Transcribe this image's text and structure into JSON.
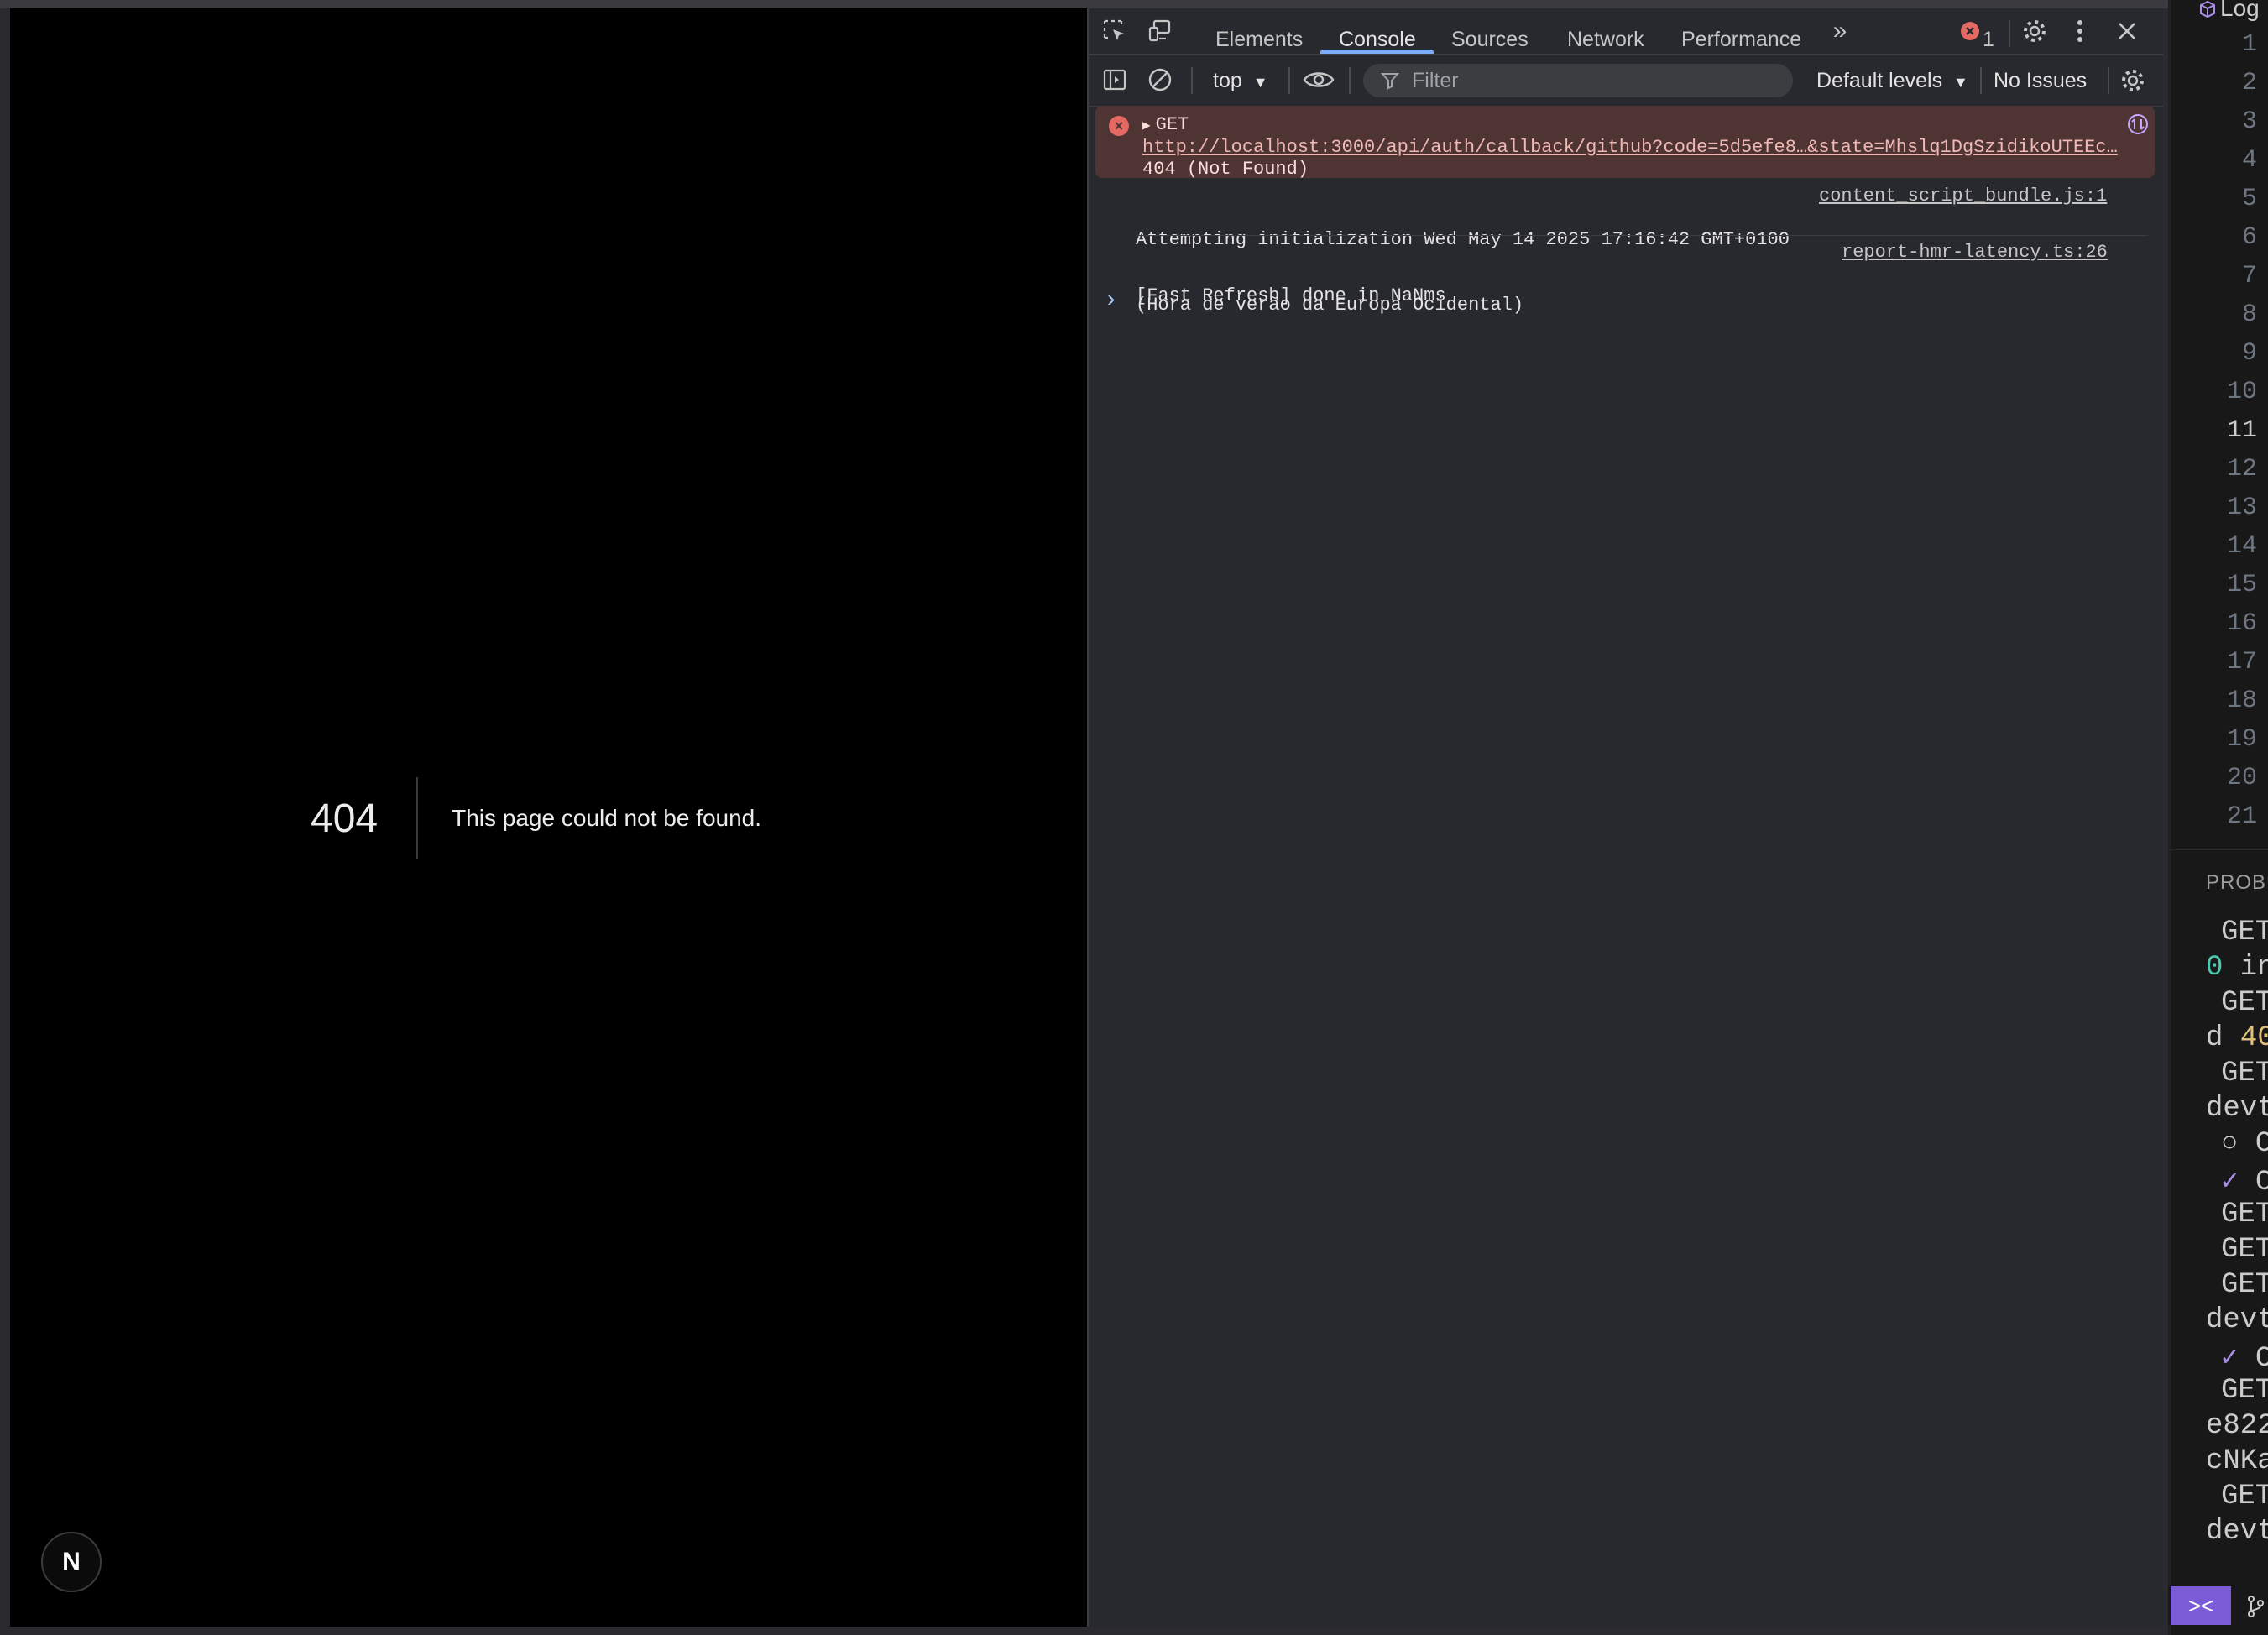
{
  "page": {
    "error_code": "404",
    "error_message": "This page could not be found.",
    "nextjs_badge": "N"
  },
  "devtools": {
    "tabs": [
      "Elements",
      "Console",
      "Sources",
      "Network",
      "Performance"
    ],
    "active_tab": "Console",
    "error_count": "1",
    "context": "top",
    "filter_placeholder": "Filter",
    "levels": "Default levels",
    "issues": "No Issues",
    "console": {
      "error": {
        "method": "GET",
        "url": "http://localhost:3000/api/auth/callback/github?code=5d5efe8…&state=Mhslq1DgSzidikoUTEEc…",
        "status": "404 (Not Found)"
      },
      "logs": [
        {
          "line1": "Attempting initialization Wed May 14 2025 17:16:42 GMT+0100",
          "line2": "(Hora de verão da Europa Ocidental)",
          "source": "content_script_bundle.js:1"
        },
        {
          "line1": "[Fast Refresh] done in NaNms",
          "source": "report-hmr-latency.ts:26"
        }
      ],
      "prompt": "›"
    }
  },
  "editor": {
    "title": "Log",
    "line_numbers": [
      "1",
      "2",
      "3",
      "4",
      "5",
      "6",
      "7",
      "8",
      "9",
      "10",
      "11",
      "12",
      "13",
      "14",
      "15",
      "16",
      "17",
      "18",
      "19",
      "20",
      "21"
    ],
    "current_line": "11",
    "panel_title": "PROBL",
    "terminal_lines": [
      "GET",
      "0 in",
      "GET",
      "d 40",
      "GET",
      "devt",
      "○ C",
      "✓ C",
      "GET",
      "GET",
      "GET",
      "devt",
      "✓ C",
      "GET",
      "e822",
      "cNKa",
      "GET",
      "devt"
    ]
  }
}
